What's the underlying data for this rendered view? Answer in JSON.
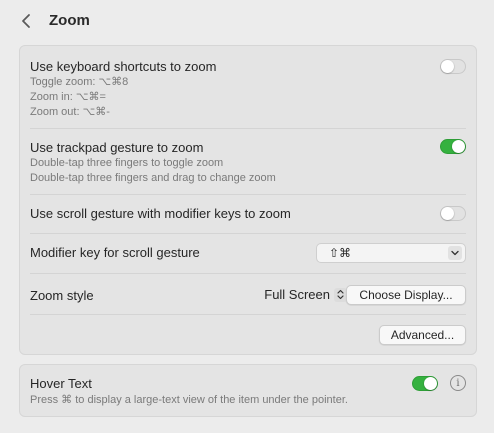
{
  "header": {
    "title": "Zoom",
    "back_icon": "chevron-left-icon"
  },
  "keyboard_shortcuts": {
    "label": "Use keyboard shortcuts to zoom",
    "line1": "Toggle zoom: ⌥⌘8",
    "line2": "Zoom in: ⌥⌘=",
    "line3": "Zoom out: ⌥⌘-",
    "enabled": false
  },
  "trackpad_gesture": {
    "label": "Use trackpad gesture to zoom",
    "line1": "Double-tap three fingers to toggle zoom",
    "line2": "Double-tap three fingers and drag to change zoom",
    "enabled": true
  },
  "scroll_gesture": {
    "label": "Use scroll gesture with modifier keys to zoom",
    "enabled": false
  },
  "modifier_key": {
    "label": "Modifier key for scroll gesture",
    "value": "⇧⌘"
  },
  "zoom_style": {
    "label": "Zoom style",
    "value": "Full Screen",
    "choose_display_label": "Choose Display..."
  },
  "advanced": {
    "label": "Advanced..."
  },
  "hover_text": {
    "label": "Hover Text",
    "description": "Press ⌘ to display a large-text view of the item under the pointer.",
    "enabled": true,
    "info_glyph": "i"
  },
  "colors": {
    "toggle_on": "#35b13f",
    "background": "#ececec",
    "panel": "#e4e4e4"
  }
}
